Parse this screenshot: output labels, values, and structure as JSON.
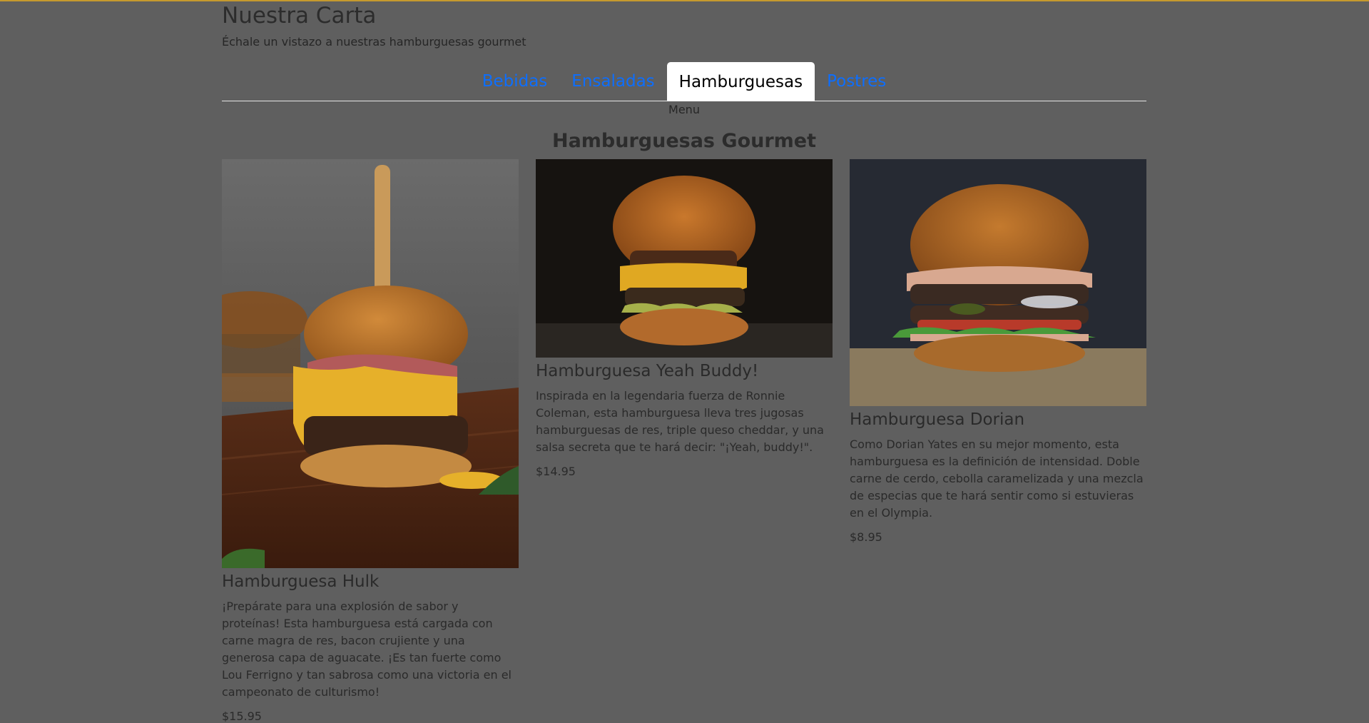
{
  "header": {
    "title": "Nuestra Carta",
    "subtitle": "Échale un vistazo a nuestras hamburguesas gourmet"
  },
  "tabs": [
    {
      "label": "Bebidas",
      "active": false
    },
    {
      "label": "Ensaladas",
      "active": false
    },
    {
      "label": "Hamburguesas",
      "active": true
    },
    {
      "label": "Postres",
      "active": false
    }
  ],
  "menu_label": "Menu",
  "section": {
    "title": "Hamburguesas Gourmet"
  },
  "items": [
    {
      "name": "Hamburguesa Hulk",
      "description": "¡Prepárate para una explosión de sabor y proteínas! Esta hamburguesa está cargada con carne magra de res, bacon crujiente y una generosa capa de aguacate. ¡Es tan fuerte como Lou Ferrigno y tan sabrosa como una victoria en el campeonato de culturismo!",
      "price": "$15.95"
    },
    {
      "name": "Hamburguesa Yeah Buddy!",
      "description": "Inspirada en la legendaria fuerza de Ronnie Coleman, esta hamburguesa lleva tres jugosas hamburguesas de res, triple queso cheddar, y una salsa secreta que te hará decir: \"¡Yeah, buddy!\".",
      "price": "$14.95"
    },
    {
      "name": "Hamburguesa Dorian",
      "description": "Como Dorian Yates en su mejor momento, esta hamburguesa es la definición de intensidad. Doble carne de cerdo, cebolla caramelizada y una mezcla de especias que te hará sentir como si estuvieras en el Olympia.",
      "price": "$8.95"
    }
  ],
  "colors": {
    "overlay_bg": "#5f5f5f",
    "tab_link": "#0d6efd",
    "tab_active_bg": "#ffffff"
  }
}
